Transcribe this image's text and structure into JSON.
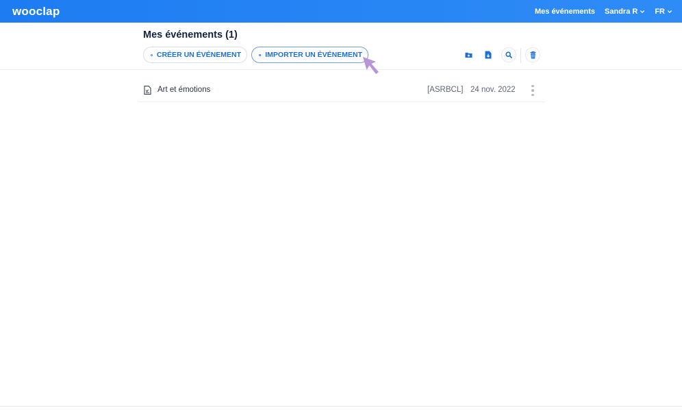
{
  "header": {
    "logo": "wooclap",
    "nav": {
      "events": "Mes événements",
      "user": "Sandra R",
      "lang": "FR"
    }
  },
  "page": {
    "title": "Mes événements (1)"
  },
  "actions": {
    "create_label": "CRÉER UN ÉVÉNEMENT",
    "import_label": "IMPORTER UN ÉVÉNEMENT"
  },
  "events": [
    {
      "name": "Art et émotions",
      "code": "[ASRBCL]",
      "date": "24 nov. 2022"
    }
  ],
  "icons": {
    "toolbar": [
      "new-folder-icon",
      "download-file-icon",
      "search-icon",
      "trash-icon"
    ],
    "row": [
      "document-icon",
      "more-vertical-icon"
    ]
  },
  "colors": {
    "brand": "#1d7cf2",
    "link": "#1d6fd8",
    "cursor": "#b48fd6"
  }
}
